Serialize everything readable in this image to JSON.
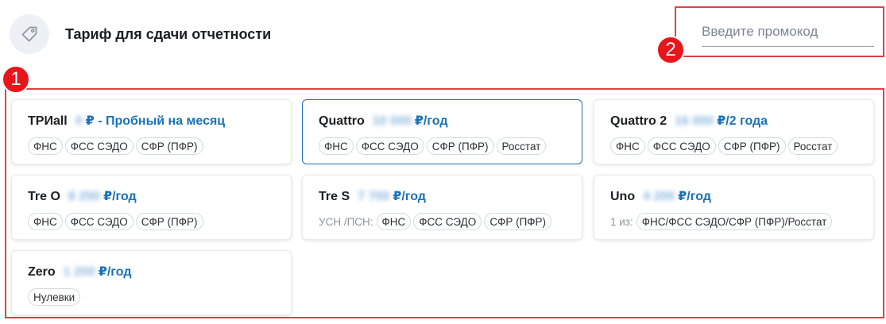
{
  "header": {
    "title": "Тариф для сдачи отчетности",
    "icon": "price-tag-icon"
  },
  "promo": {
    "placeholder": "Введите промокод"
  },
  "markers": [
    "1",
    "2"
  ],
  "colors": {
    "accent": "#1a72b8",
    "highlight": "#e53e44",
    "marker": "#e8151b"
  },
  "tariffs": [
    {
      "name": "ТРИall",
      "price": "0",
      "suffix": "₽ - Пробный на месяц",
      "prefix": "",
      "tags": [
        "ФНС",
        "ФСС СЭДО",
        "СФР (ПФР)"
      ],
      "selected": false
    },
    {
      "name": "Quattro",
      "price": "10 000",
      "suffix": "₽/год",
      "prefix": "",
      "tags": [
        "ФНС",
        "ФСС СЭДО",
        "СФР (ПФР)",
        "Росстат"
      ],
      "selected": true
    },
    {
      "name": "Quattro 2",
      "price": "16 000",
      "suffix": "₽/2 года",
      "prefix": "",
      "tags": [
        "ФНС",
        "ФСС СЭДО",
        "СФР (ПФР)",
        "Росстат"
      ],
      "selected": false
    },
    {
      "name": "Tre O",
      "price": "8 250",
      "suffix": "₽/год",
      "prefix": "",
      "tags": [
        "ФНС",
        "ФСС СЭДО",
        "СФР (ПФР)"
      ],
      "selected": false
    },
    {
      "name": "Tre S",
      "price": "7 700",
      "suffix": "₽/год",
      "prefix": "УСН /ПСН:",
      "tags": [
        "ФНС",
        "ФСС СЭДО",
        "СФР (ПФР)"
      ],
      "selected": false
    },
    {
      "name": "Uno",
      "price": "4 200",
      "suffix": "₽/год",
      "prefix": "1 из:",
      "tags": [
        "ФНС/ФСС СЭДО/СФР (ПФР)/Росстат"
      ],
      "selected": false
    },
    {
      "name": "Zero",
      "price": "1 200",
      "suffix": "₽/год",
      "prefix": "",
      "tags": [
        "Нулевки"
      ],
      "selected": false
    }
  ]
}
